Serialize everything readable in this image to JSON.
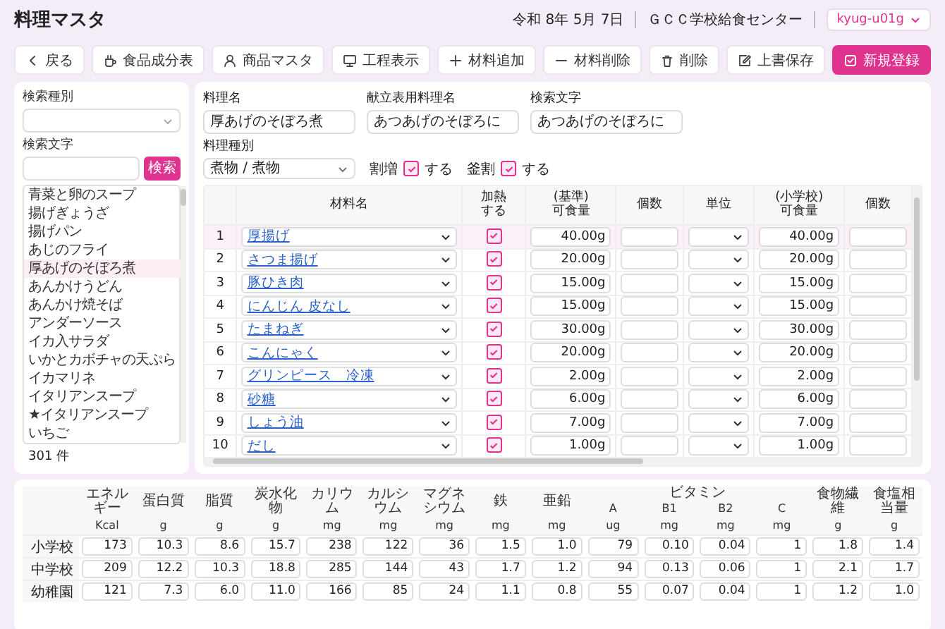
{
  "header": {
    "title": "料理マスタ",
    "date": "令和 8年 5月 7日",
    "facility": "ＧＣＣ学校給食センター",
    "user": "kyug-u01g"
  },
  "toolbar": {
    "left": [
      {
        "label": "戻る",
        "kind": "plain"
      },
      {
        "label": "食品成分表",
        "kind": "plain"
      },
      {
        "label": "商品マスタ",
        "kind": "plain"
      }
    ],
    "right": [
      {
        "label": "工程表示",
        "kind": "plain"
      },
      {
        "label": "材料追加",
        "kind": "plain"
      },
      {
        "label": "材料削除",
        "kind": "plain"
      },
      {
        "label": "削除",
        "kind": "plain"
      },
      {
        "label": "上書保存",
        "kind": "plain"
      },
      {
        "label": "新規登録",
        "kind": "primary"
      }
    ]
  },
  "search_panel": {
    "type_label": "検索種別",
    "text_label": "検索文字",
    "search_button": "検索",
    "count": "301 件",
    "items": [
      {
        "label": "青菜と卵のスープ",
        "selected": false
      },
      {
        "label": "揚げぎょうざ",
        "selected": false
      },
      {
        "label": "揚げパン",
        "selected": false
      },
      {
        "label": "あじのフライ",
        "selected": false
      },
      {
        "label": "厚あげのそぼろ煮",
        "selected": true
      },
      {
        "label": "あんかけうどん",
        "selected": false
      },
      {
        "label": "あんかけ焼そば",
        "selected": false
      },
      {
        "label": "アンダーソース",
        "selected": false
      },
      {
        "label": "イカ入サラダ",
        "selected": false
      },
      {
        "label": "いかとカボチャの天ぷら",
        "selected": false
      },
      {
        "label": "イカマリネ",
        "selected": false
      },
      {
        "label": "イタリアンスープ",
        "selected": false
      },
      {
        "label": "★イタリアンスープ",
        "selected": false
      },
      {
        "label": "いちご",
        "selected": false
      }
    ]
  },
  "dish": {
    "fields": [
      {
        "label": "料理名",
        "value": "厚あげのそぼろ煮"
      },
      {
        "label": "献立表用料理名",
        "value": "あつあげのそぼろに"
      },
      {
        "label": "検索文字",
        "value": "あつあげのそぼろに"
      }
    ],
    "type_label": "料理種別",
    "type_value": "煮物 / 煮物",
    "options": [
      {
        "label": "割増",
        "checked": true,
        "text": "する"
      },
      {
        "label": "釜割",
        "checked": true,
        "text": "する"
      }
    ]
  },
  "ingredients": {
    "columns": [
      "材料名",
      "加熱する",
      "(基準)\n可食量",
      "個数",
      "単位",
      "(小学校)\n可食量",
      "個数"
    ],
    "rows": [
      {
        "no": "1",
        "name": "厚揚げ",
        "heated": true,
        "base": "40.00g",
        "school": "40.00g",
        "selected": true
      },
      {
        "no": "2",
        "name": "さつま揚げ",
        "heated": true,
        "base": "20.00g",
        "school": "20.00g",
        "selected": false
      },
      {
        "no": "3",
        "name": "豚ひき肉",
        "heated": true,
        "base": "15.00g",
        "school": "15.00g",
        "selected": false
      },
      {
        "no": "4",
        "name": "にんじん 皮なし",
        "heated": true,
        "base": "15.00g",
        "school": "15.00g",
        "selected": false
      },
      {
        "no": "5",
        "name": "たまねぎ",
        "heated": true,
        "base": "30.00g",
        "school": "30.00g",
        "selected": false
      },
      {
        "no": "6",
        "name": "こんにゃく",
        "heated": true,
        "base": "20.00g",
        "school": "20.00g",
        "selected": false
      },
      {
        "no": "7",
        "name": "グリンピース　冷凍",
        "heated": true,
        "base": "2.00g",
        "school": "2.00g",
        "selected": false
      },
      {
        "no": "8",
        "name": "砂糖",
        "heated": true,
        "base": "6.00g",
        "school": "6.00g",
        "selected": false
      },
      {
        "no": "9",
        "name": "しょう油",
        "heated": true,
        "base": "7.00g",
        "school": "7.00g",
        "selected": false
      },
      {
        "no": "10",
        "name": "だし",
        "heated": true,
        "base": "1.00g",
        "school": "1.00g",
        "selected": false
      }
    ]
  },
  "nutrition": {
    "vitamin_group": "ビタミン",
    "columns": [
      {
        "name": "エネルギー",
        "unit": "Kcal",
        "kind": "single"
      },
      {
        "name": "蛋白質",
        "unit": "g",
        "kind": "single"
      },
      {
        "name": "脂質",
        "unit": "g",
        "kind": "single"
      },
      {
        "name": "炭水化物",
        "unit": "g",
        "kind": "single"
      },
      {
        "name": "カリウム",
        "unit": "mg",
        "kind": "single"
      },
      {
        "name": "カルシウム",
        "unit": "mg",
        "kind": "single"
      },
      {
        "name": "マグネシウム",
        "unit": "mg",
        "kind": "single"
      },
      {
        "name": "鉄",
        "unit": "mg",
        "kind": "single"
      },
      {
        "name": "亜鉛",
        "unit": "mg",
        "kind": "single"
      },
      {
        "name": "A",
        "unit": "ug",
        "kind": "vitamin"
      },
      {
        "name": "B1",
        "unit": "mg",
        "kind": "vitamin"
      },
      {
        "name": "B2",
        "unit": "mg",
        "kind": "vitamin"
      },
      {
        "name": "C",
        "unit": "mg",
        "kind": "vitamin"
      },
      {
        "name": "食物繊維",
        "unit": "g",
        "kind": "single"
      },
      {
        "name": "食塩相当量",
        "unit": "g",
        "kind": "single"
      }
    ],
    "rows": [
      {
        "label": "小学校",
        "values": [
          "173",
          "10.3",
          "8.6",
          "15.7",
          "238",
          "122",
          "36",
          "1.5",
          "1.0",
          "79",
          "0.10",
          "0.04",
          "1",
          "1.8",
          "1.4"
        ]
      },
      {
        "label": "中学校",
        "values": [
          "209",
          "12.2",
          "10.3",
          "18.8",
          "285",
          "144",
          "43",
          "1.7",
          "1.2",
          "94",
          "0.13",
          "0.06",
          "1",
          "2.1",
          "1.7"
        ]
      },
      {
        "label": "幼稚園",
        "values": [
          "121",
          "7.3",
          "6.0",
          "11.0",
          "166",
          "85",
          "24",
          "1.1",
          "0.8",
          "55",
          "0.07",
          "0.04",
          "1",
          "1.2",
          "1.0"
        ]
      }
    ]
  }
}
